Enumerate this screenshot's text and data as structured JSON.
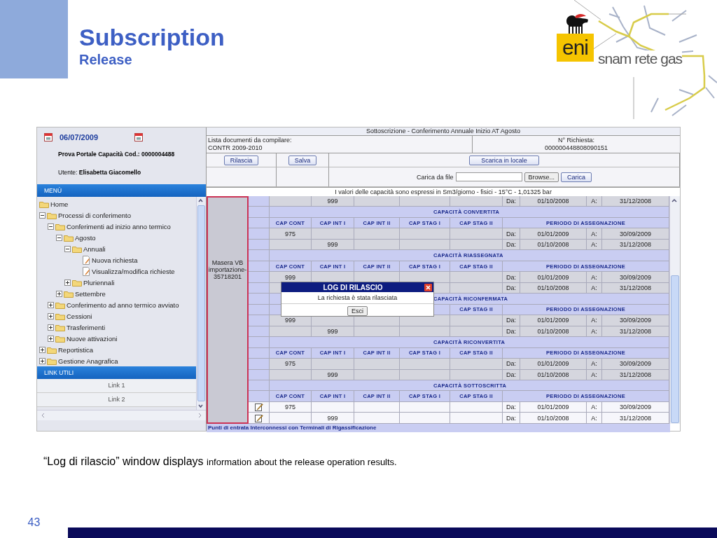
{
  "slide": {
    "title": "Subscription",
    "subtitle": "Release",
    "caption": {
      "lead": "“Log di rilascio” window displays",
      "rest": "information about the release operation results."
    },
    "page_number": "43"
  },
  "logos": {
    "eni": "eni",
    "snam": "snam rete gas"
  },
  "sidebar": {
    "date": "06/07/2009",
    "portal": "Prova Portale Capacità Cod.: 0000004488",
    "user": "Utente: **Elisabetta Giacomello**",
    "menu_title": "MENÙ",
    "tree": [
      {
        "label": "Home",
        "kind": "folder"
      },
      {
        "label": "Processi di conferimento",
        "kind": "group",
        "expanded": true,
        "children": [
          {
            "label": "Conferimenti ad inizio anno termico",
            "kind": "group",
            "expanded": true,
            "children": [
              {
                "label": "Agosto",
                "kind": "group",
                "expanded": true,
                "children": [
                  {
                    "label": "Annuali",
                    "kind": "group",
                    "expanded": true,
                    "children": [
                      {
                        "label": "Nuova richiesta",
                        "kind": "document"
                      },
                      {
                        "label": "Visualizza/modifica richieste",
                        "kind": "document"
                      }
                    ]
                  },
                  {
                    "label": "Pluriennali",
                    "kind": "group",
                    "expanded": false
                  }
                ]
              },
              {
                "label": "Settembre",
                "kind": "group",
                "expanded": false
              }
            ]
          },
          {
            "label": "Conferimento ad anno termico avviato",
            "kind": "group",
            "expanded": false
          },
          {
            "label": "Cessioni",
            "kind": "group",
            "expanded": false
          },
          {
            "label": "Trasferimenti",
            "kind": "group",
            "expanded": false
          },
          {
            "label": "Nuove attivazioni",
            "kind": "group",
            "expanded": false
          }
        ]
      },
      {
        "label": "Reportistica",
        "kind": "group",
        "expanded": false
      },
      {
        "label": "Gestione Anagrafica",
        "kind": "group",
        "expanded": false
      }
    ],
    "links_title": "LINK UTILI",
    "links": [
      "Link 1",
      "Link 2"
    ]
  },
  "form": {
    "title": "Sottoscrizione - Conferimento Annuale Inizio AT Agosto",
    "documents_label": "Lista documenti da compilare:",
    "documents_value": "CONTR 2009-2010",
    "request_label": "N° Richiesta:",
    "request_number": "000000448808090151",
    "buttons": [
      "Rilascia",
      "Salva"
    ],
    "download_button": "Scarica in locale",
    "upload_label": "Carica da file",
    "browse_button": "Browse...",
    "upload_button": "Carica",
    "note": "I valori delle capacità sono espressi in Sm3/giorno - fisici - 15°C - 1,01325 bar"
  },
  "grid": {
    "point": "Masera VB importazione-35718201",
    "rows": [
      {
        "kind": "data",
        "editable": false,
        "cells": [
          null,
          "999",
          null,
          null,
          null,
          "Da:",
          "01/10/2008",
          "A:",
          "31/12/2008"
        ]
      },
      {
        "kind": "section",
        "title": "CAPACITÀ CONVERTITA"
      },
      {
        "kind": "header",
        "cells": [
          "CAP CONT",
          "CAP INT I",
          "CAP INT II",
          "CAP STAG I",
          "CAP STAG II",
          "PERIODO DI ASSEGNAZIONE"
        ]
      },
      {
        "kind": "data",
        "editable": false,
        "cells": [
          "975",
          null,
          null,
          null,
          null,
          "Da:",
          "01/01/2009",
          "A:",
          "30/09/2009"
        ]
      },
      {
        "kind": "data",
        "editable": false,
        "cells": [
          null,
          "999",
          null,
          null,
          null,
          "Da:",
          "01/10/2008",
          "A:",
          "31/12/2008"
        ]
      },
      {
        "kind": "section",
        "title": "CAPACITÀ RIASSEGNATA"
      },
      {
        "kind": "header",
        "cells": [
          "CAP CONT",
          "CAP INT I",
          "CAP INT II",
          "CAP STAG I",
          "CAP STAG II",
          "PERIODO DI ASSEGNAZIONE"
        ]
      },
      {
        "kind": "data",
        "editable": false,
        "cells": [
          "999",
          null,
          null,
          null,
          null,
          "Da:",
          "01/01/2009",
          "A:",
          "30/09/2009"
        ]
      },
      {
        "kind": "data",
        "editable": false,
        "cells": [
          null,
          null,
          null,
          null,
          null,
          "Da:",
          "01/10/2008",
          "A:",
          "31/12/2008"
        ]
      },
      {
        "kind": "section",
        "title": "CAPACITÀ RICONFERMATA"
      },
      {
        "kind": "header",
        "cells": [
          null,
          null,
          null,
          null,
          "CAP STAG II",
          "PERIODO DI ASSEGNAZIONE"
        ]
      },
      {
        "kind": "data",
        "editable": false,
        "cells": [
          "999",
          null,
          null,
          null,
          null,
          "Da:",
          "01/01/2009",
          "A:",
          "30/09/2009"
        ]
      },
      {
        "kind": "data",
        "editable": false,
        "cells": [
          null,
          "999",
          null,
          null,
          null,
          "Da:",
          "01/10/2008",
          "A:",
          "31/12/2008"
        ]
      },
      {
        "kind": "section",
        "title": "CAPACITÀ RICONVERTITA"
      },
      {
        "kind": "header",
        "cells": [
          "CAP CONT",
          "CAP INT I",
          "CAP INT II",
          "CAP STAG I",
          "CAP STAG II",
          "PERIODO DI ASSEGNAZIONE"
        ]
      },
      {
        "kind": "data",
        "editable": false,
        "cells": [
          "975",
          null,
          null,
          null,
          null,
          "Da:",
          "01/01/2009",
          "A:",
          "30/09/2009"
        ]
      },
      {
        "kind": "data",
        "editable": false,
        "cells": [
          null,
          "999",
          null,
          null,
          null,
          "Da:",
          "01/10/2008",
          "A:",
          "31/12/2008"
        ]
      },
      {
        "kind": "section",
        "title": "CAPACITÀ SOTTOSCRITTA"
      },
      {
        "kind": "header",
        "cells": [
          "CAP CONT",
          "CAP INT I",
          "CAP INT II",
          "CAP STAG I",
          "CAP STAG II",
          "PERIODO DI ASSEGNAZIONE"
        ]
      },
      {
        "kind": "data",
        "editable": true,
        "cells": [
          "975",
          null,
          null,
          null,
          null,
          "Da:",
          "01/01/2009",
          "A:",
          "30/09/2009"
        ]
      },
      {
        "kind": "data",
        "editable": true,
        "cells": [
          null,
          "999",
          null,
          null,
          null,
          "Da:",
          "01/10/2008",
          "A:",
          "31/12/2008"
        ]
      }
    ],
    "footer": "Punti di entrata Interconnessi con Terminali di Rigassificazione"
  },
  "dialog": {
    "title": "LOG DI RILASCIO",
    "message": "La richiesta è stata rilasciata",
    "button": "Esci"
  }
}
